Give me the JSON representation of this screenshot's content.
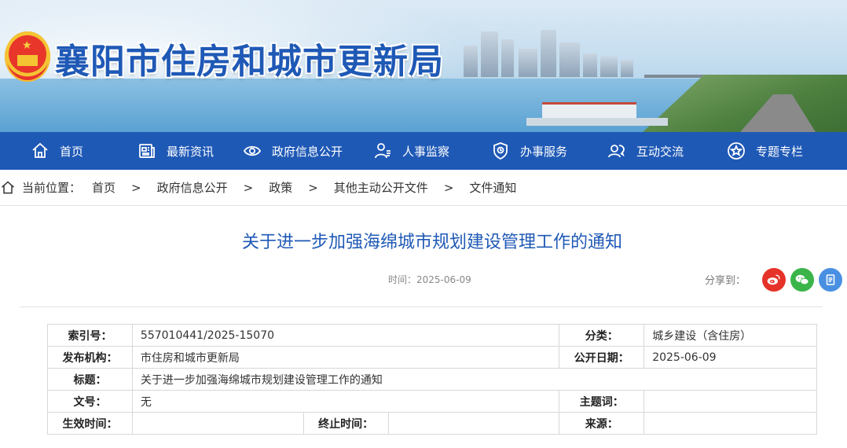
{
  "site": {
    "title": "襄阳市住房和城市更新局"
  },
  "nav": {
    "items": [
      {
        "label": "首页",
        "icon": "home-icon"
      },
      {
        "label": "最新资讯",
        "icon": "news-icon"
      },
      {
        "label": "政府信息公开",
        "icon": "eye-icon"
      },
      {
        "label": "人事监察",
        "icon": "person-icon"
      },
      {
        "label": "办事服务",
        "icon": "shield-icon"
      },
      {
        "label": "互动交流",
        "icon": "chat-icon"
      },
      {
        "label": "专题专栏",
        "icon": "star-icon"
      }
    ]
  },
  "breadcrumb": {
    "prefix": "当前位置：",
    "items": [
      "首页",
      "政府信息公开",
      "政策",
      "其他主动公开文件",
      "文件通知"
    ],
    "separator": ">"
  },
  "article": {
    "title": "关于进一步加强海绵城市规划建设管理工作的通知",
    "time": "时间：2025-06-09",
    "share_label": "分享到："
  },
  "share": {
    "weibo_color": "#e6332a",
    "wechat_color": "#3bb54a",
    "other_color": "#4a90e2"
  },
  "info": {
    "index_key": "索引号：",
    "index_val": "557010441/2025-15070",
    "category_key": "分类：",
    "category_val": "城乡建设（含住房）",
    "publisher_key": "发布机构：",
    "publisher_val": "市住房和城市更新局",
    "date_key": "公开日期：",
    "date_val": "2025-06-09",
    "title_key": "标题：",
    "title_val": "关于进一步加强海绵城市规划建设管理工作的通知",
    "docno_key": "文号：",
    "docno_val": "无",
    "subject_key": "主题词：",
    "subject_val": "",
    "effective_key": "生效时间：",
    "effective_val": "",
    "end_key": "终止时间：",
    "end_val": "",
    "source_key": "来源：",
    "source_val": ""
  }
}
